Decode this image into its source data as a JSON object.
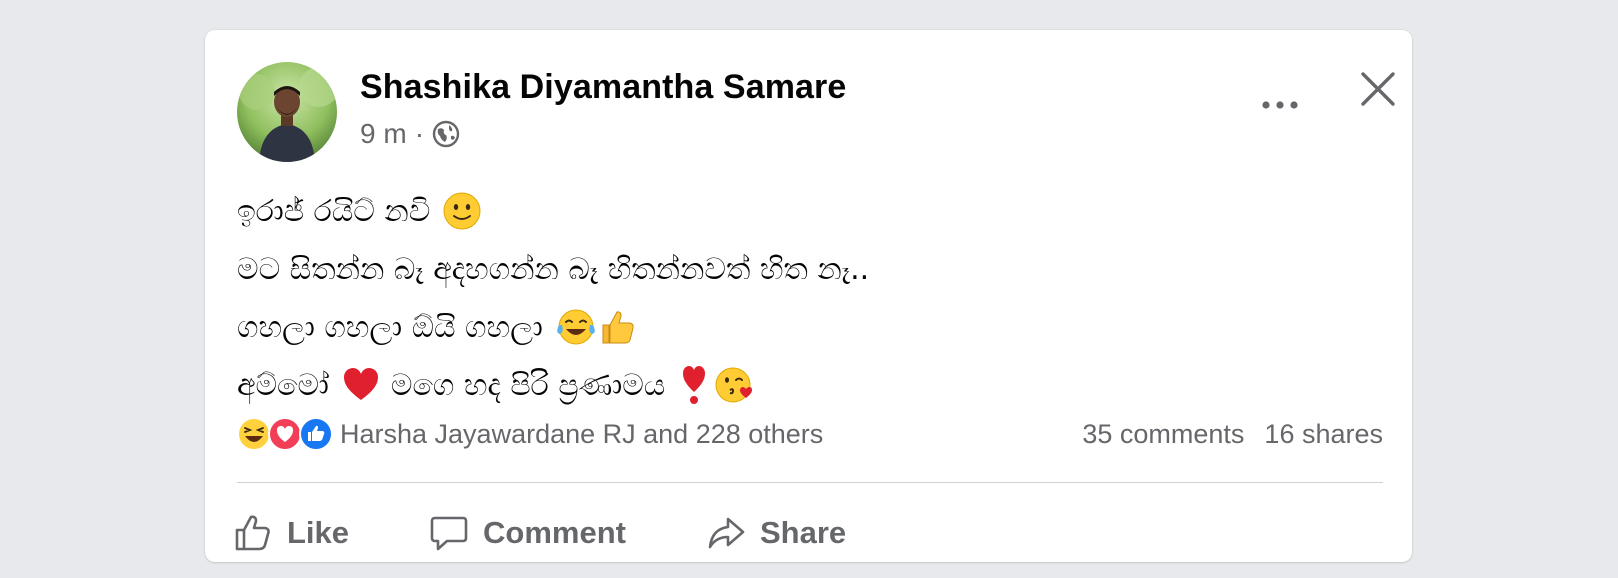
{
  "post": {
    "author": "Shashika Diyamantha Samare",
    "time": "9 m",
    "separator": "·",
    "lines": [
      "ඉරාජ් රයිට් නවි",
      "මට සිතන්න බෑ අදහගන්න බෑ හිතන්නවත් හිත නෑ..",
      "ගහලා ගහලා ඕයි ගහලා",
      "අම්මෝ",
      "මගෙ හද පිරි ප්‍රණාමය"
    ]
  },
  "reactions": {
    "text": "Harsha Jayawardane RJ and 228 others",
    "icons": [
      "haha-icon",
      "love-icon",
      "like-icon"
    ]
  },
  "stats": {
    "comments": "35 comments",
    "shares": "16 shares"
  },
  "actions": {
    "like": "Like",
    "comment": "Comment",
    "share": "Share"
  },
  "icons": {
    "privacy": "globe-icon",
    "more": "more-icon",
    "close": "close-icon"
  },
  "colors": {
    "background": "#e8e9ec",
    "card": "#ffffff",
    "secondary_text": "#65676b",
    "primary_text": "#050505",
    "like_blue": "#1877f2",
    "love_red": "#f33e58"
  }
}
